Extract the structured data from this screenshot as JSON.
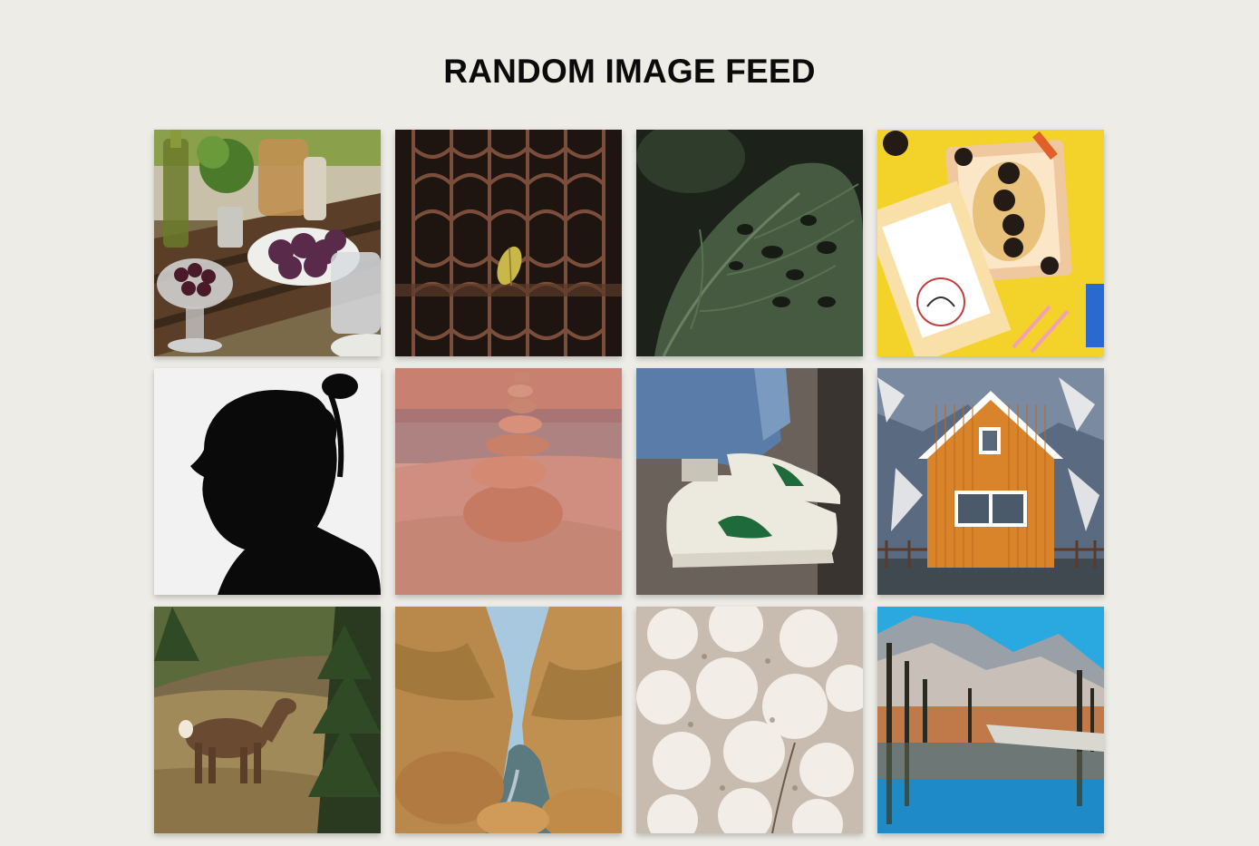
{
  "page": {
    "title": "RANDOM IMAGE FEED",
    "background": "#edece7"
  },
  "feed": {
    "items": [
      {
        "subject": "table with figs, olive oil and glasses",
        "dominant_colors": [
          "#5a4a3a",
          "#7a5a7a",
          "#6f8a3a"
        ]
      },
      {
        "subject": "ornate metal grate with yellow leaf",
        "dominant_colors": [
          "#2b1d17",
          "#6b4a3a",
          "#c4b34a"
        ]
      },
      {
        "subject": "dark green monstera leaf",
        "dominant_colors": [
          "#2c3429",
          "#4b5a45",
          "#1a2019"
        ]
      },
      {
        "subject": "oreo dessert box on yellow background",
        "dominant_colors": [
          "#f2d12b",
          "#e8c08a",
          "#2a1f1a"
        ]
      },
      {
        "subject": "silhouette of bearded man with man bun",
        "dominant_colors": [
          "#f2f2f2",
          "#0a0a0a"
        ]
      },
      {
        "subject": "stacked rock cairn in canyon",
        "dominant_colors": [
          "#c9857a",
          "#e3a79a",
          "#7a5a5a"
        ]
      },
      {
        "subject": "white sneakers with green logo and jeans",
        "dominant_colors": [
          "#e9e6dc",
          "#1f6a3a",
          "#5a7aa0"
        ]
      },
      {
        "subject": "orange wooden house with white windows",
        "dominant_colors": [
          "#d9832a",
          "#5a6a7e",
          "#ffffff"
        ]
      },
      {
        "subject": "deer in forest clearing",
        "dominant_colors": [
          "#6a5a3a",
          "#3a4a2a",
          "#a08a5a"
        ]
      },
      {
        "subject": "rocky canyon with river",
        "dominant_colors": [
          "#b88a4a",
          "#a0c8e0",
          "#6a7a7a"
        ]
      },
      {
        "subject": "white blossoms close-up",
        "dominant_colors": [
          "#e8e2d8",
          "#b8aca0",
          "#7a6a5a"
        ]
      },
      {
        "subject": "mountain valley reflected in lake",
        "dominant_colors": [
          "#2aa8e0",
          "#c88a5a",
          "#5a4a3a"
        ]
      }
    ]
  }
}
